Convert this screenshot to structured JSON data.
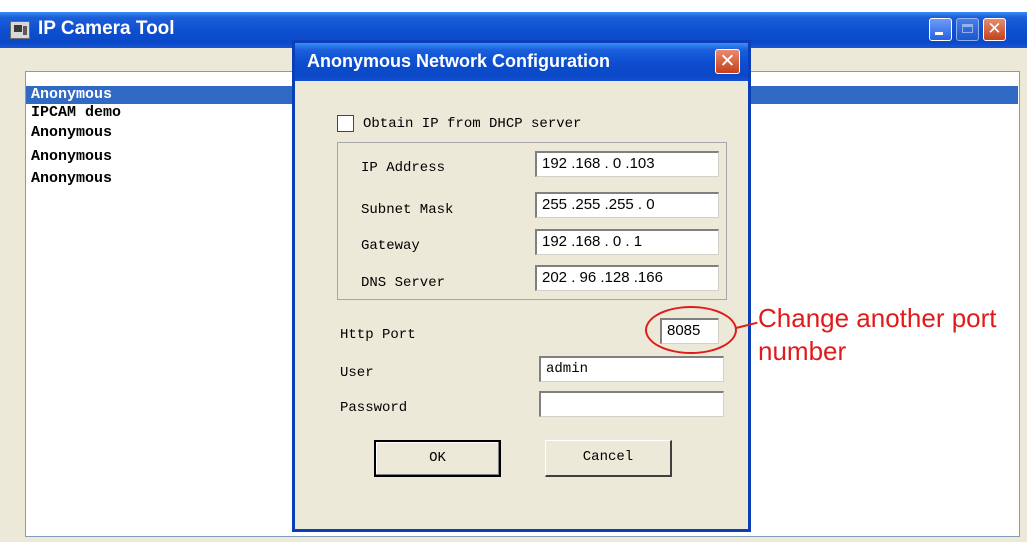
{
  "main_window": {
    "title": "IP Camera Tool",
    "camera_list": [
      "Anonymous",
      "IPCAM demo",
      "Anonymous",
      "Anonymous",
      "Anonymous"
    ]
  },
  "dialog": {
    "title": "Anonymous Network Configuration",
    "close_glyph": "✕",
    "dhcp_label": "Obtain IP from DHCP server",
    "dhcp_checked": false,
    "ip_address_label": "IP Address",
    "ip_address_value": "192 .168 . 0  .103",
    "subnet_mask_label": "Subnet Mask",
    "subnet_mask_value": "255 .255 .255 . 0",
    "gateway_label": "Gateway",
    "gateway_value": "192 .168 . 0  . 1",
    "dns_server_label": "DNS Server",
    "dns_server_value": "202 . 96  .128 .166",
    "http_port_label": "Http Port",
    "http_port_value": "8085",
    "user_label": "User",
    "user_value": "admin",
    "password_label": "Password",
    "password_value": "",
    "ok_label": "OK",
    "cancel_label": "Cancel"
  },
  "annotation": {
    "text": "Change another port number",
    "color": "#e01b1b"
  },
  "colors": {
    "titlebar_blue": "#0a49c8",
    "selection": "#316ac5",
    "window_bg": "#ece9d8"
  }
}
